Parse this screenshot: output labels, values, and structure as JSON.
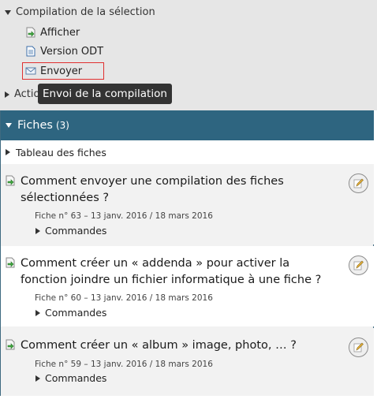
{
  "sidebar": {
    "section_title": "Compilation de la sélection",
    "items": [
      {
        "label": "Afficher",
        "icon": "arrow-page-icon"
      },
      {
        "label": "Version ODT",
        "icon": "document-icon"
      },
      {
        "label": "Envoyer",
        "icon": "envelope-icon"
      }
    ],
    "actions_label": "Actio",
    "tooltip": "Envoi de la compilation"
  },
  "panel": {
    "title": "Fiches",
    "count": "(3)",
    "table_toggle": "Tableau des fiches",
    "cards": [
      {
        "title": "Comment envoyer une compilation des fiches sélectionnées ?",
        "meta": "Fiche n° 63 – 13 janv. 2016 / 18 mars 2016",
        "commands": "Commandes"
      },
      {
        "title": "Comment créer un « addenda » pour activer la fonction joindre un fichier informatique à une fiche ?",
        "meta": "Fiche n° 60 – 13 janv. 2016 / 18 mars 2016",
        "commands": "Commandes"
      },
      {
        "title": "Comment créer un « album » image, photo, …  ?",
        "meta": "Fiche n° 59 – 13 janv. 2016 / 18 mars 2016",
        "commands": "Commandes"
      }
    ]
  },
  "colors": {
    "panel_header": "#2e6580",
    "top_background": "#e6e6e6",
    "tooltip_background": "#333333",
    "highlight_border": "#e03030"
  }
}
